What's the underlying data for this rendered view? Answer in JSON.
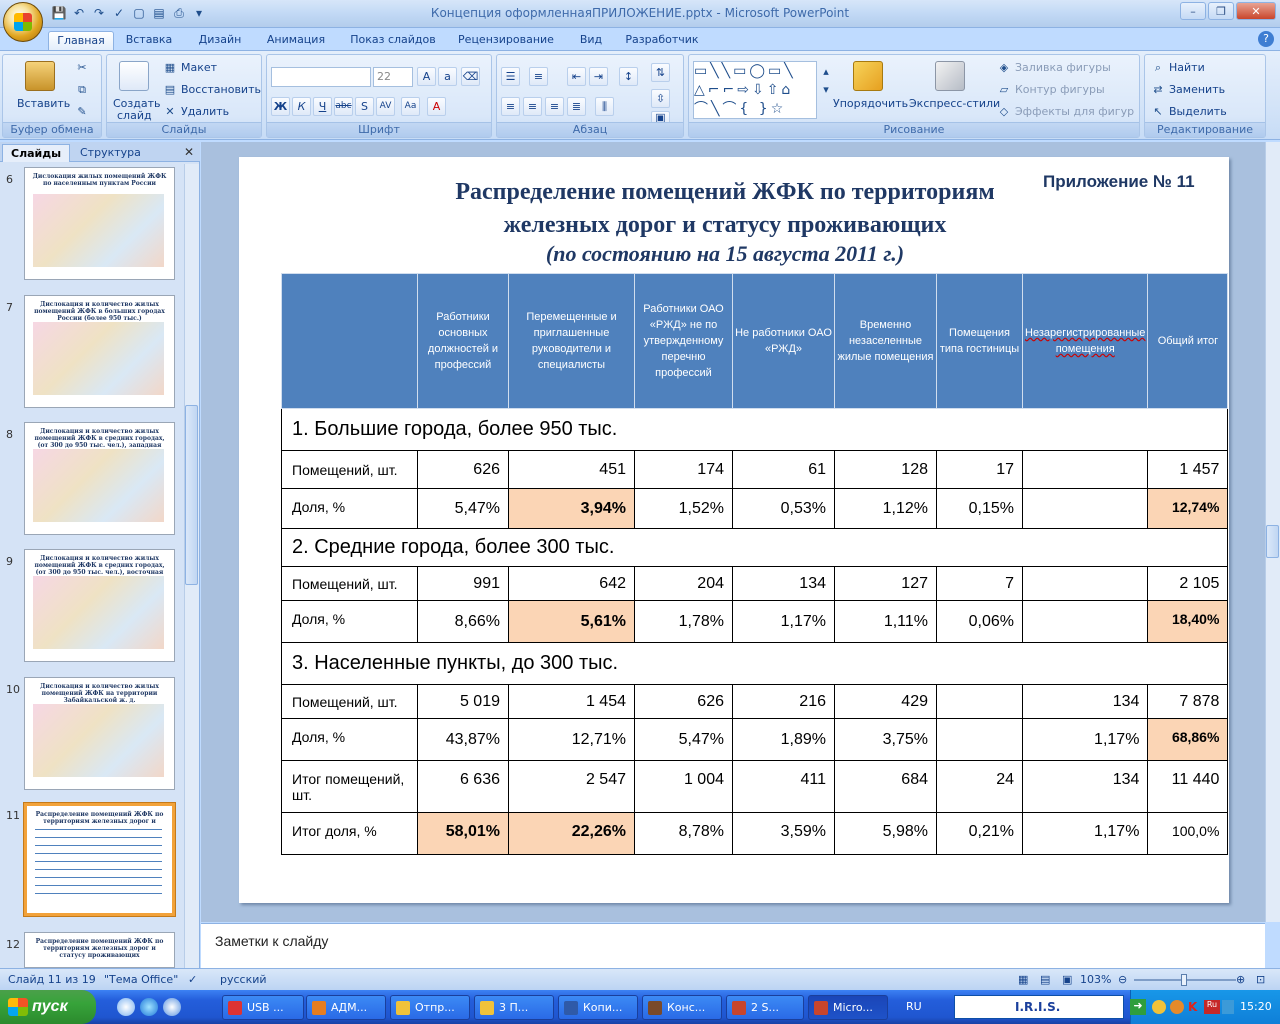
{
  "window": {
    "title": "Концепция оформленнаяПРИЛОЖЕНИЕ.pptx - Microsoft PowerPoint"
  },
  "tabs": [
    "Главная",
    "Вставка",
    "Дизайн",
    "Анимация",
    "Показ слайдов",
    "Рецензирование",
    "Вид",
    "Разработчик"
  ],
  "ribbon": {
    "clipboard": {
      "label": "Буфер обмена",
      "paste": "Вставить"
    },
    "slides": {
      "label": "Слайды",
      "create": "Создать",
      "create2": "слайд",
      "layout": "Макет",
      "reset": "Восстановить",
      "delete": "Удалить"
    },
    "font": {
      "label": "Шрифт",
      "size": "22"
    },
    "paragraph": {
      "label": "Абзац"
    },
    "drawing": {
      "label": "Рисование",
      "arrange": "Упорядочить",
      "styles": "Экспресс-стили",
      "fill": "Заливка фигуры",
      "outline": "Контур фигуры",
      "effects": "Эффекты для фигур"
    },
    "editing": {
      "label": "Редактирование",
      "find": "Найти",
      "replace": "Заменить",
      "select": "Выделить"
    }
  },
  "pane": {
    "tab_slides": "Слайды",
    "tab_outline": "Структура"
  },
  "thumbs": [
    {
      "num": "6",
      "title": "Дислокация жилых помещений ЖФК по населенным пунктам России"
    },
    {
      "num": "7",
      "title": "Дислокация и количество жилых помещений ЖФК в больших городах России (более 950 тыс.)"
    },
    {
      "num": "8",
      "title": "Дислокация и количество жилых помещений ЖФК в средних городах, (от 300 до 950 тыс. чел.), западная часть России"
    },
    {
      "num": "9",
      "title": "Дислокация и количество жилых помещений ЖФК в средних городах, (от 300 до 950 тыс. чел.), восточная часть России"
    },
    {
      "num": "10",
      "title": "Дислокация и количество жилых помещений ЖФК на территории Забайкальской ж. д."
    },
    {
      "num": "11",
      "title": "Распределение помещений ЖФК по территориям железных дорог и статусу проживающих"
    },
    {
      "num": "12",
      "title": "Распределение помещений ЖФК по территориям железных дорог и статусу проживающих"
    }
  ],
  "slide": {
    "appendix": "Приложение № 11",
    "title1": "Распределение помещений ЖФК по территориям",
    "title2": "железных дорог и статусу проживающих",
    "subtitle": "(по состоянию на 15 августа 2011 г.)",
    "headers": [
      "Работники основных должностей и профессий",
      "Перемещенные и приглашенные руководители и специалисты",
      "Работники ОАО «РЖД» не по утвержденному перечню профессий",
      "Не работники ОАО «РЖД»",
      "Временно незаселенные жилые помещения",
      "Помещения типа гостиницы",
      "Незарегистрированные помещения",
      "Общий итог"
    ],
    "sections": [
      {
        "title": "1. Большие города, более 950 тыс.",
        "rooms": {
          "label": "Помещений, шт.",
          "values": [
            "626",
            "451",
            "174",
            "61",
            "128",
            "17",
            "",
            "1 457"
          ]
        },
        "share": {
          "label": "Доля, %",
          "values": [
            "5,47%",
            "3,94%",
            "1,52%",
            "0,53%",
            "1,12%",
            "0,15%",
            "",
            "12,74%"
          ]
        }
      },
      {
        "title": "2. Средние города, более 300 тыс.",
        "rooms": {
          "label": "Помещений, шт.",
          "values": [
            "991",
            "642",
            "204",
            "134",
            "127",
            "7",
            "",
            "2 105"
          ]
        },
        "share": {
          "label": "Доля, %",
          "values": [
            "8,66%",
            "5,61%",
            "1,78%",
            "1,17%",
            "1,11%",
            "0,06%",
            "",
            "18,40%"
          ]
        }
      },
      {
        "title": "3. Населенные пункты, до 300 тыс.",
        "rooms": {
          "label": "Помещений, шт.",
          "values": [
            "5 019",
            "1 454",
            "626",
            "216",
            "429",
            "",
            "134",
            "7 878"
          ]
        },
        "share": {
          "label": "Доля, %",
          "values": [
            "43,87%",
            "12,71%",
            "5,47%",
            "1,89%",
            "3,75%",
            "",
            "1,17%",
            "68,86%"
          ]
        }
      }
    ],
    "total_rooms": {
      "label": "Итог помещений, шт.",
      "values": [
        "6 636",
        "2 547",
        "1 004",
        "411",
        "684",
        "24",
        "134",
        "11 440"
      ]
    },
    "total_share": {
      "label": "Итог доля, %",
      "values": [
        "58,01%",
        "22,26%",
        "8,78%",
        "3,59%",
        "5,98%",
        "0,21%",
        "1,17%",
        "100,0%"
      ]
    },
    "highlight_color": "#fbd5b5",
    "header_color": "#4f81bd"
  },
  "notes": {
    "placeholder": "Заметки к слайду"
  },
  "status": {
    "slide": "Слайд 11 из 19",
    "theme": "\"Тема Office\"",
    "lang": "русский",
    "zoom": "103%"
  },
  "taskbar": {
    "start": "пуск",
    "items": [
      "USB ...",
      "АДМ...",
      "Отпр...",
      "3 П...",
      "Копи...",
      "Конс...",
      "2 S...",
      "Micro..."
    ],
    "lang": "RU",
    "iris": "I.R.I.S.",
    "clock": "15:20"
  }
}
